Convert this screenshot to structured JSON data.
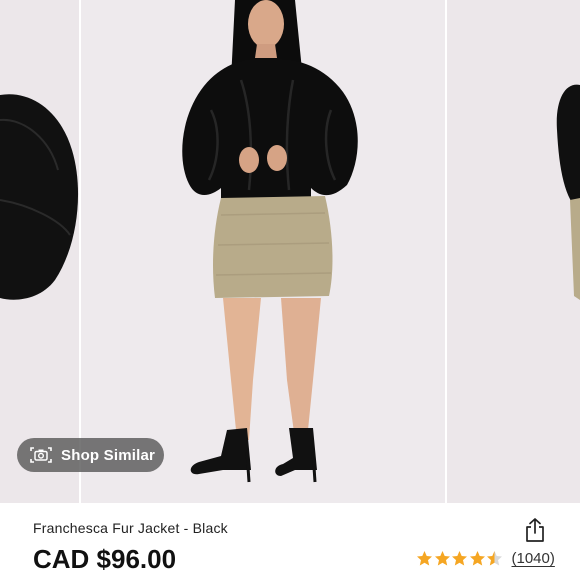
{
  "gallery": {
    "current_index": 2,
    "shop_similar": {
      "label": "Shop Similar",
      "icon": "camera-scan-icon"
    },
    "colors": {
      "backdrop": "#ece7ea",
      "brand_red": "#c8161e"
    }
  },
  "product": {
    "title": "Franchesca Fur Jacket - Black",
    "price": "CAD $96.00",
    "rating": {
      "value": 4.5,
      "max": 5,
      "reviews": "(1040)",
      "star_color": "#f5a623"
    },
    "share_icon": "share-icon"
  }
}
